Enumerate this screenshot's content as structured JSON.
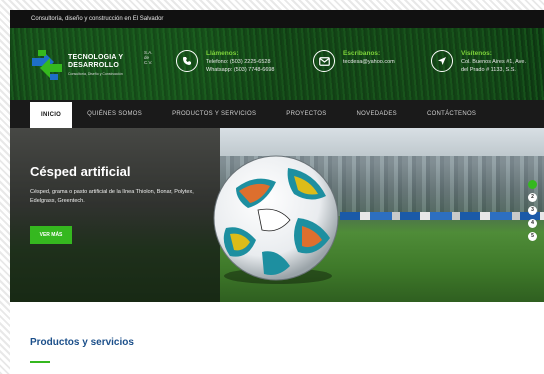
{
  "topbar": {
    "text": "Consultoría, diseño y construcción en El Salvador"
  },
  "logo": {
    "title_line1": "TECNOLOGIA Y",
    "title_line2": "DESARROLLO",
    "sa": "S.A. de C.V.",
    "subtitle": "Consultoría, Diseño y Construcción",
    "colors": {
      "blue": "#1e6fc7",
      "green": "#35b81f"
    }
  },
  "contacts": [
    {
      "icon": "phone-icon",
      "title": "Llámenos:",
      "lines": [
        "Telefono: (503) 2225-6528",
        "Whatsapp: (503) 7748-6698"
      ]
    },
    {
      "icon": "mail-icon",
      "title": "Escribanos:",
      "lines": [
        "tecdesa@yahoo.com"
      ]
    },
    {
      "icon": "location-arrow-icon",
      "title": "Visítenos:",
      "lines": [
        "Col. Buenos Aires #1, Ave.",
        "del Prado # 1133, S.S."
      ]
    }
  ],
  "nav": {
    "items": [
      "INICIO",
      "QUIÉNES SOMOS",
      "PRODUCTOS Y SERVICIOS",
      "PROYECTOS",
      "NOVEDADES",
      "CONTÁCTENOS"
    ],
    "active": "INICIO"
  },
  "hero": {
    "title": "Césped artificial",
    "description": "Césped, grama o pasto artificial de la línea Thiolon, Bonar, Polytex, Edelgrass, Greentech.",
    "button": "VER MÁS",
    "slides": [
      "1",
      "2",
      "3",
      "4",
      "5"
    ],
    "active_slide": "1"
  },
  "section": {
    "title": "Productos y servicios"
  },
  "colors": {
    "accent_green": "#35b81f",
    "heading_blue": "#1b4f8a",
    "nav_bg": "#1a1a1a"
  }
}
